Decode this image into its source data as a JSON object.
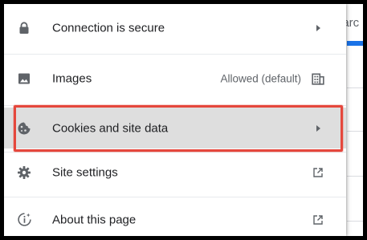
{
  "background": {
    "search_text": "earc"
  },
  "menu": {
    "items": [
      {
        "label": "Connection is secure",
        "icon": "lock-icon",
        "trail_icon": "chevron-right-icon"
      },
      {
        "label": "Images",
        "icon": "image-icon",
        "status": "Allowed (default)",
        "trail_icon": "building-icon"
      },
      {
        "label": "Cookies and site data",
        "icon": "cookie-icon",
        "trail_icon": "chevron-right-icon"
      },
      {
        "label": "Site settings",
        "icon": "gear-icon",
        "trail_icon": "open-external-icon"
      },
      {
        "label": "About this page",
        "icon": "google-info-icon",
        "trail_icon": "open-external-icon"
      }
    ]
  },
  "colors": {
    "highlight_outline": "#e5473c",
    "accent": "#1a73e8",
    "icon": "#5f6368",
    "text": "#202124"
  }
}
